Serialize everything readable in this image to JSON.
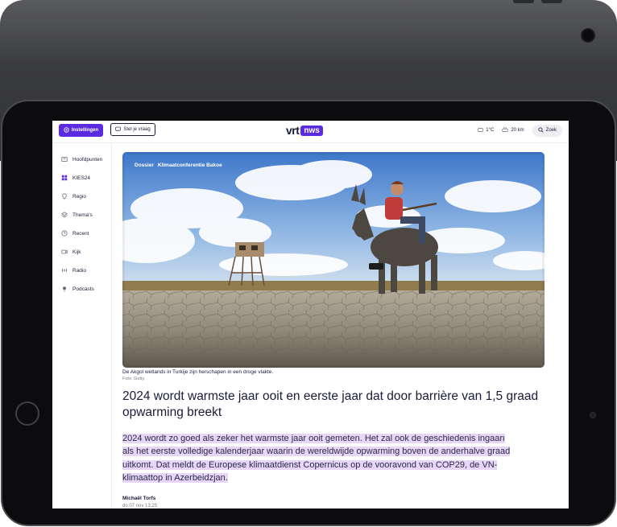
{
  "topbar": {
    "settings_label": "Instellingen",
    "ask_label": "Stel je vraag",
    "logo_vrt": "vrt",
    "logo_nws": "nws",
    "temperature": "1°C",
    "distance": "20 km",
    "search_label": "Zoek"
  },
  "sidebar": {
    "items": [
      {
        "label": "Hoofdpunten",
        "icon": "headlines-icon"
      },
      {
        "label": "KIES24",
        "icon": "grid-icon"
      },
      {
        "label": "Regio",
        "icon": "location-pin-icon"
      },
      {
        "label": "Thema's",
        "icon": "layers-icon"
      },
      {
        "label": "Recent",
        "icon": "clock-icon"
      },
      {
        "label": "Kijk",
        "icon": "video-icon"
      },
      {
        "label": "Radio",
        "icon": "radio-icon"
      },
      {
        "label": "Podcasts",
        "icon": "podcast-icon"
      }
    ]
  },
  "article": {
    "tag_dossier": "Dossier",
    "tag_topic": "Klimaatconferentie Bakoe",
    "caption": "De Akgol wetlands in Turkije zijn herschapen in een droge vlakte.",
    "credit": "Foto: Getty",
    "headline": "2024 wordt warmste jaar ooit en eerste jaar dat door barrière van 1,5 graad opwarming breekt",
    "lead": "2024 wordt zo goed als zeker het warmste jaar ooit gemeten. Het zal ook de geschiedenis ingaan als het eerste volledige kalenderjaar waarin de wereldwijde opwarming boven de anderhalve graad uitkomt. Dat meldt de Europese klimaatdienst Copernicus op de vooravond van COP29, de VN-klimaattop in Azerbeidzjan.",
    "author": "Michaël Torfs",
    "date": "do 07 nov   13:25"
  },
  "colors": {
    "brand": "#5a2be0",
    "text": "#1b1b3a",
    "highlight": "#e7d6f7"
  }
}
